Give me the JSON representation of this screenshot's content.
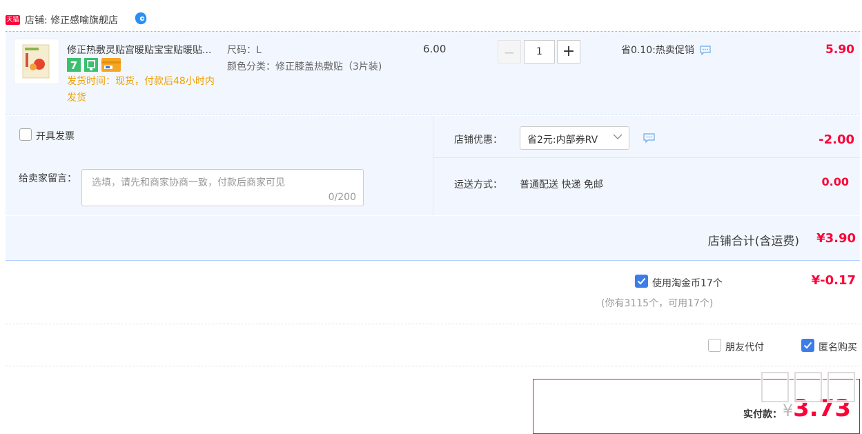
{
  "shop": {
    "badge": "天猫",
    "name": "店铺: 修正感喻旗舰店"
  },
  "item": {
    "title": "修正热敷灵贴宫暖贴宝宝贴暖贴...",
    "service_icons": [
      "seven-day-return-icon",
      "guarantee-icon",
      "credit-card-icon"
    ],
    "delivery": "发货时间：现货，付款后48小时内发货",
    "sku_size": "尺码：L",
    "sku_color": "颜色分类：修正膝盖热敷贴（3片装)",
    "unit_price": "6.00",
    "quantity": "1",
    "qty_minus": "−",
    "qty_plus": "+",
    "promotion": "省0.10:热卖促销",
    "subtotal": "5.90"
  },
  "options": {
    "invoice_label": "开具发票",
    "message_label": "给卖家留言：",
    "message_placeholder": "选填，请先和商家协商一致，付款后商家可见",
    "message_count": "0/200",
    "shop_discount_label": "店铺优惠：",
    "coupon_selected": "省2元:内部券RV",
    "discount_value": "-2.00",
    "shipping_label": "运送方式：",
    "shipping_method": "普通配送 快递 免邮",
    "shipping_fee": "0.00"
  },
  "shop_total": {
    "label": "店铺合计(含运费)",
    "value": "¥3.90"
  },
  "coins": {
    "label": "使用淘金币17个",
    "sub": "(你有3115个，可用17个)",
    "value": "¥-0.17",
    "checked": true
  },
  "pay_options": {
    "friend_pay": "朋友代付",
    "anonymous": "匿名购买",
    "anonymous_checked": true
  },
  "final": {
    "label": "实付款：",
    "currency": "¥",
    "amount": "3.73"
  },
  "colors": {
    "accent_red": "#ff0036",
    "check_blue": "#3d7dea",
    "panel_bg": "#f2f7ff",
    "delivery_orange": "#f0a000"
  }
}
